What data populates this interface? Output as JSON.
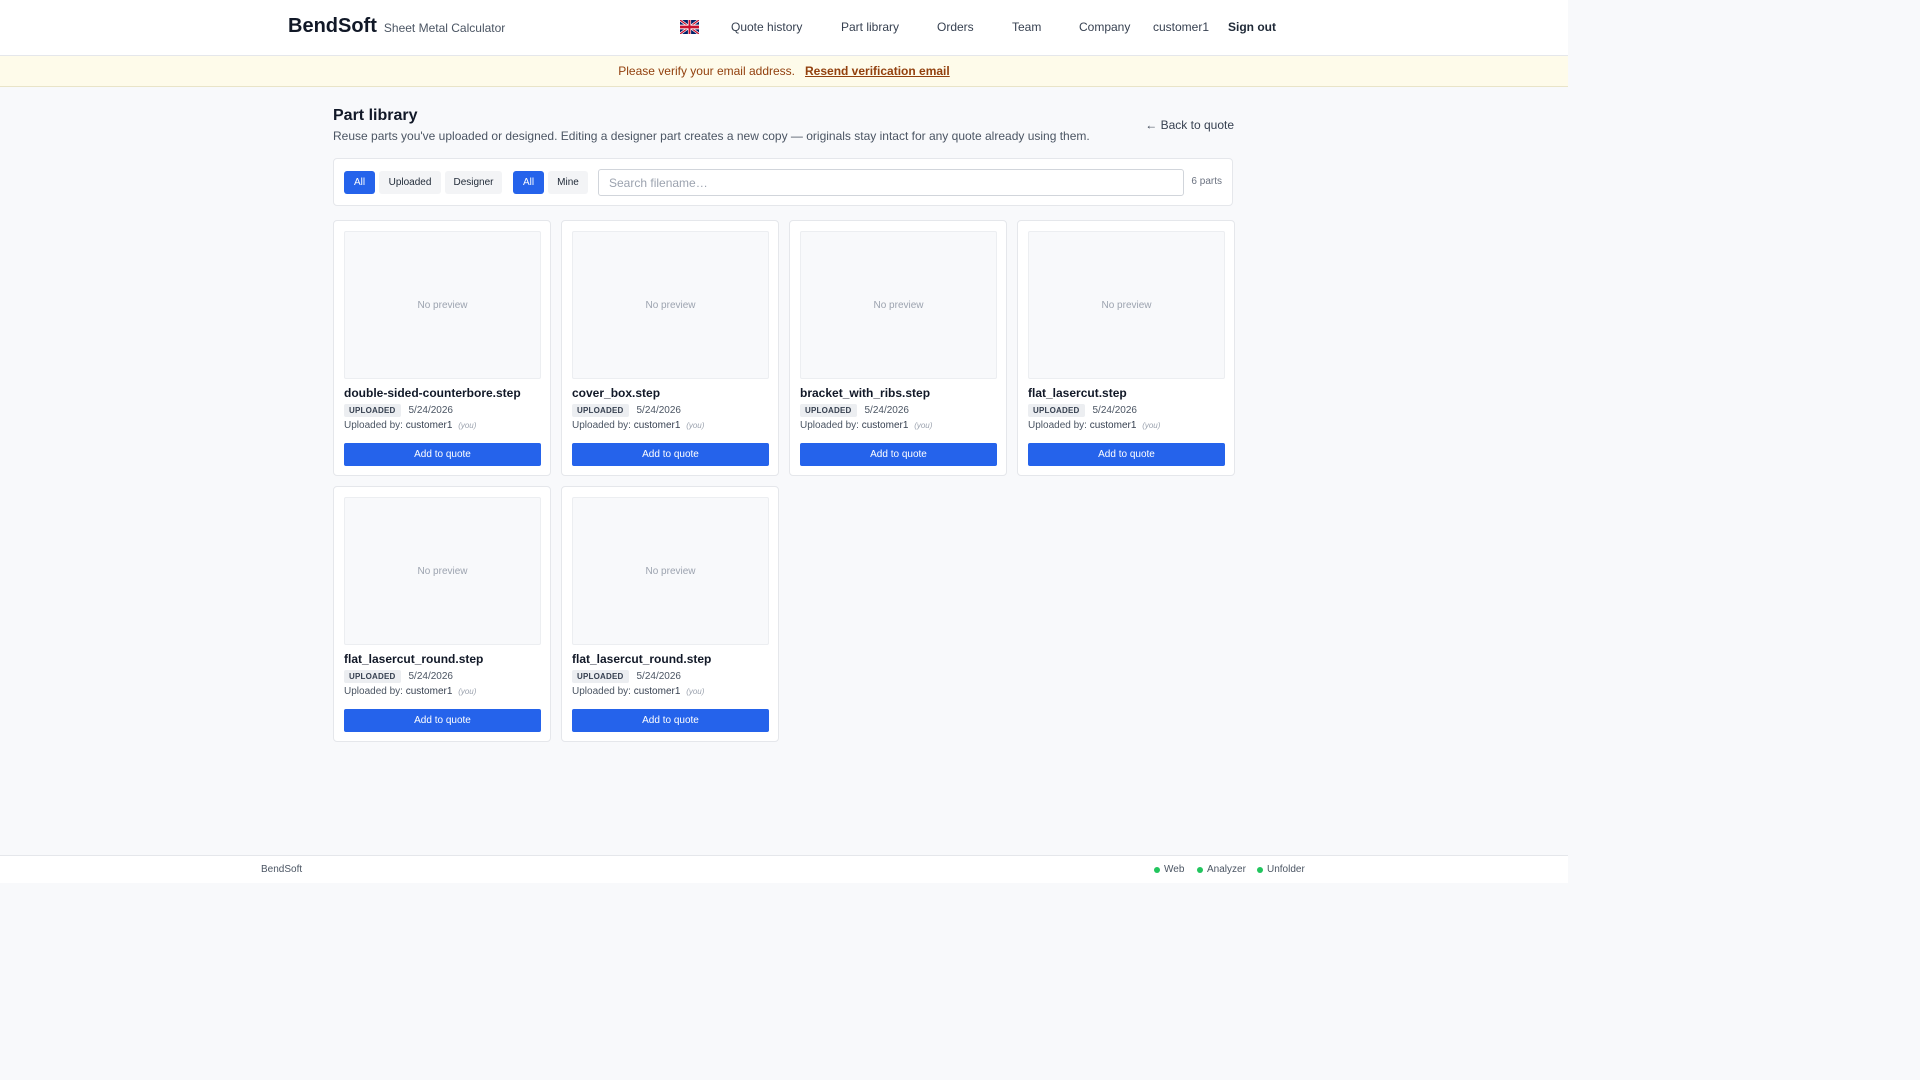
{
  "header": {
    "brand": "BendSoft",
    "brand_sub": "Sheet Metal Calculator",
    "nav": [
      "Quote history",
      "Part library",
      "Orders",
      "Team",
      "Company"
    ],
    "user": "customer1",
    "sign_out": "Sign out",
    "language_icon": "uk-flag-icon"
  },
  "banner": {
    "text": "Please verify your email address.",
    "link": "Resend verification email"
  },
  "page": {
    "title": "Part library",
    "subtitle": "Reuse parts you've uploaded or designed. Editing a designer part creates a new copy — originals stay intact for any quote already using them.",
    "back_link": "← Back to quote"
  },
  "filters": {
    "source": [
      "All",
      "Uploaded",
      "Designer"
    ],
    "source_selected": "All",
    "owner": [
      "All",
      "Mine"
    ],
    "owner_selected": "All",
    "search_placeholder": "Search filename…",
    "count": "6 parts"
  },
  "parts": [
    {
      "filename": "double-sided-counterbore.step",
      "badge": "UPLOADED",
      "date": "5/24/2026",
      "uploaded_by_label": "Uploaded by:",
      "uploader": "customer1",
      "you": "(you)",
      "preview": "No preview",
      "button": "Add to quote"
    },
    {
      "filename": "cover_box.step",
      "badge": "UPLOADED",
      "date": "5/24/2026",
      "uploaded_by_label": "Uploaded by:",
      "uploader": "customer1",
      "you": "(you)",
      "preview": "No preview",
      "button": "Add to quote"
    },
    {
      "filename": "bracket_with_ribs.step",
      "badge": "UPLOADED",
      "date": "5/24/2026",
      "uploaded_by_label": "Uploaded by:",
      "uploader": "customer1",
      "you": "(you)",
      "preview": "No preview",
      "button": "Add to quote"
    },
    {
      "filename": "flat_lasercut.step",
      "badge": "UPLOADED",
      "date": "5/24/2026",
      "uploaded_by_label": "Uploaded by:",
      "uploader": "customer1",
      "you": "(you)",
      "preview": "No preview",
      "button": "Add to quote"
    },
    {
      "filename": "flat_lasercut_round.step",
      "badge": "UPLOADED",
      "date": "5/24/2026",
      "uploaded_by_label": "Uploaded by:",
      "uploader": "customer1",
      "you": "(you)",
      "preview": "No preview",
      "button": "Add to quote"
    },
    {
      "filename": "flat_lasercut_round.step",
      "badge": "UPLOADED",
      "date": "5/24/2026",
      "uploaded_by_label": "Uploaded by:",
      "uploader": "customer1",
      "you": "(you)",
      "preview": "No preview",
      "button": "Add to quote"
    }
  ],
  "footer": {
    "brand": "BendSoft",
    "statuses": [
      "Web",
      "Analyzer",
      "Unfolder"
    ],
    "status_color": "#22c55e"
  },
  "colors": {
    "accent": "#2563eb",
    "banner_bg": "#fefbea",
    "banner_text": "#92400e"
  }
}
